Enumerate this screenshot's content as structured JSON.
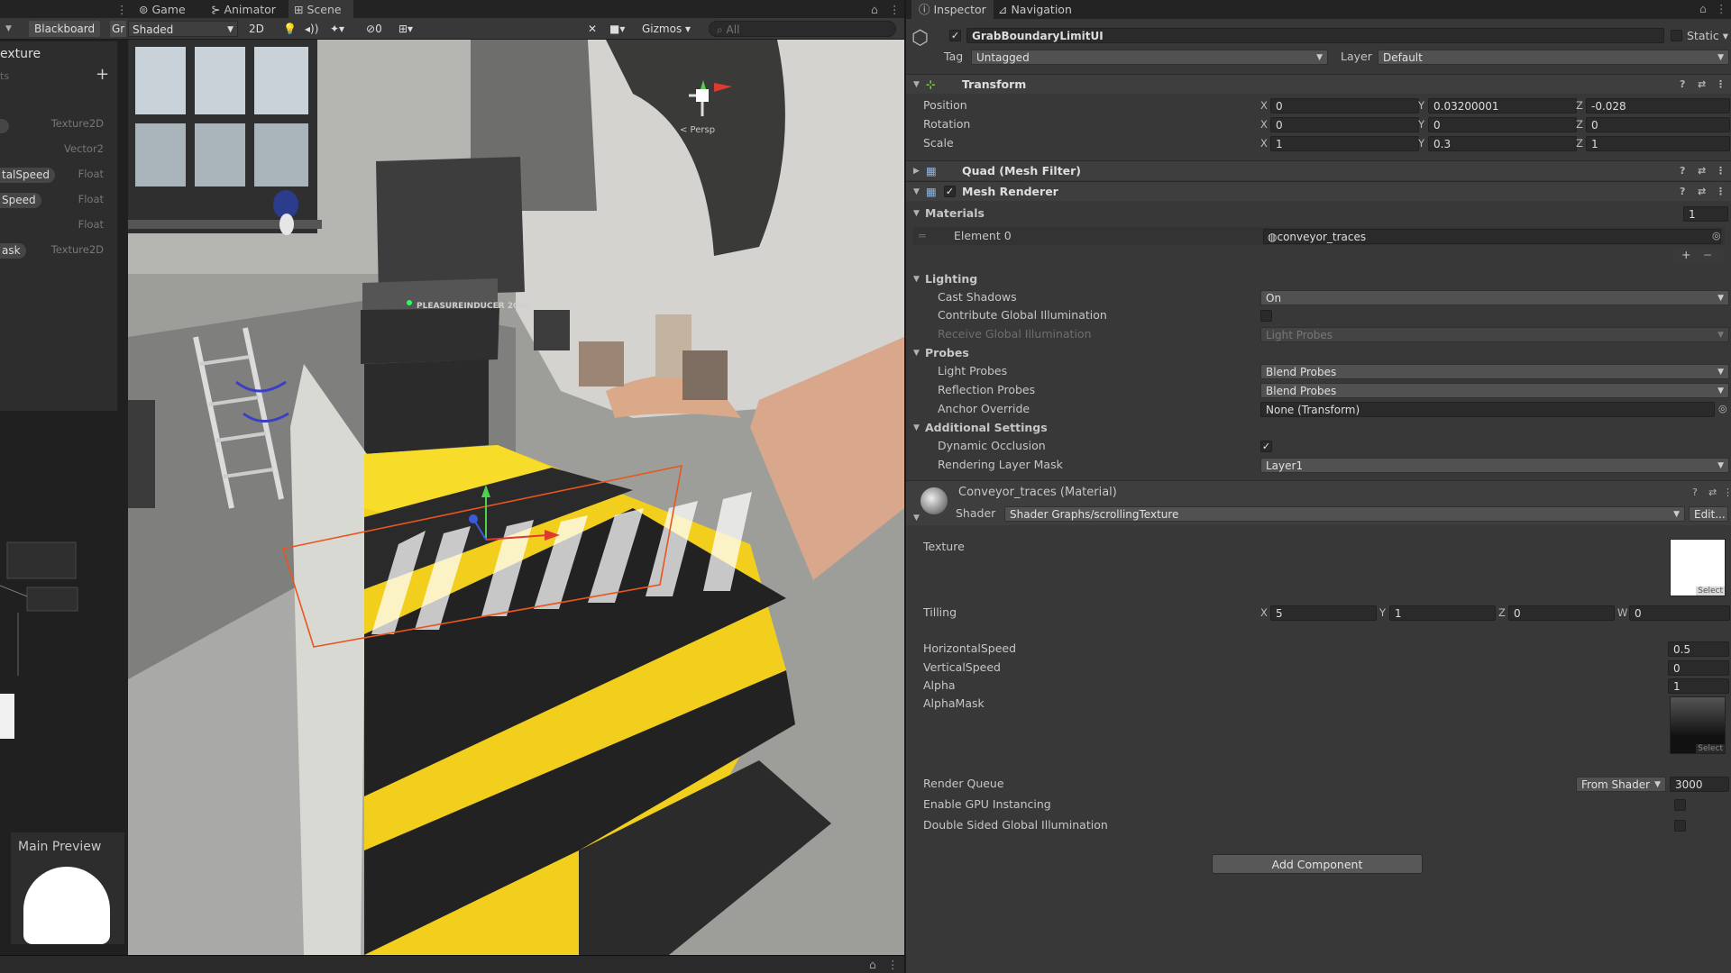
{
  "tabs": {
    "game": "Game",
    "animator": "Animator",
    "scene": "Scene"
  },
  "toolbar": {
    "blackboard": "Blackboard",
    "gr": "Gr",
    "shading": "Shaded",
    "mode_2d": "2D",
    "hidden_count": "0",
    "gizmos": "Gizmos",
    "search_placeholder": "All"
  },
  "blackboard": {
    "title": "exture",
    "subtitle": "ts",
    "properties": [
      {
        "name": "",
        "type": "Texture2D"
      },
      {
        "name": "",
        "type": "Vector2"
      },
      {
        "name": "talSpeed",
        "type": "Float"
      },
      {
        "name": "Speed",
        "type": "Float"
      },
      {
        "name": "",
        "type": "Float"
      },
      {
        "name": "ask",
        "type": "Texture2D"
      }
    ]
  },
  "main_preview": {
    "title": "Main Preview"
  },
  "scene": {
    "persp_label": "< Persp",
    "machine_label": "PLEASUREINDUCER 2000"
  },
  "inspector": {
    "tabs": {
      "inspector": "Inspector",
      "navigation": "Navigation"
    },
    "object_name": "GrabBoundaryLimitUI",
    "static_label": "Static",
    "tag_label": "Tag",
    "tag_value": "Untagged",
    "layer_label": "Layer",
    "layer_value": "Default",
    "transform": {
      "title": "Transform",
      "rows": [
        {
          "label": "Position",
          "x": "0",
          "y": "0.03200001",
          "z": "-0.028"
        },
        {
          "label": "Rotation",
          "x": "0",
          "y": "0",
          "z": "0"
        },
        {
          "label": "Scale",
          "x": "1",
          "y": "0.3",
          "z": "1"
        }
      ]
    },
    "mesh_filter": {
      "title": "Quad (Mesh Filter)"
    },
    "mesh_renderer": {
      "title": "Mesh Renderer",
      "materials_label": "Materials",
      "materials_count": "1",
      "element0_label": "Element 0",
      "element0_value": "conveyor_traces",
      "lighting_label": "Lighting",
      "cast_shadows_label": "Cast Shadows",
      "cast_shadows_value": "On",
      "contribute_gi_label": "Contribute Global Illumination",
      "receive_gi_label": "Receive Global Illumination",
      "receive_gi_value": "Light Probes",
      "probes_label": "Probes",
      "light_probes_label": "Light Probes",
      "light_probes_value": "Blend Probes",
      "reflection_probes_label": "Reflection Probes",
      "reflection_probes_value": "Blend Probes",
      "anchor_override_label": "Anchor Override",
      "anchor_override_value": "None (Transform)",
      "additional_label": "Additional Settings",
      "dynamic_occlusion_label": "Dynamic Occlusion",
      "rendering_layer_label": "Rendering Layer Mask",
      "rendering_layer_value": "Layer1"
    },
    "material": {
      "title": "Conveyor_traces (Material)",
      "shader_label": "Shader",
      "shader_value": "Shader Graphs/scrollingTexture",
      "edit_label": "Edit...",
      "texture_label": "Texture",
      "select_label": "Select",
      "tilling_label": "Tilling",
      "tilling": {
        "x": "5",
        "y": "1",
        "z": "0",
        "w": "0"
      },
      "horizontal_speed_label": "HorizontalSpeed",
      "horizontal_speed": "0.5",
      "vertical_speed_label": "VerticalSpeed",
      "vertical_speed": "0",
      "alpha_label": "Alpha",
      "alpha": "1",
      "alpha_mask_label": "AlphaMask",
      "render_queue_label": "Render Queue",
      "render_queue_source": "From Shader",
      "render_queue_value": "3000",
      "gpu_instancing_label": "Enable GPU Instancing",
      "double_sided_gi_label": "Double Sided Global Illumination"
    },
    "add_component": "Add Component"
  },
  "colors": {
    "selection_outline": "#e8561e",
    "stripe_yellow": "#f2cf1d",
    "stripe_black": "#222222",
    "panel": "#383838"
  }
}
